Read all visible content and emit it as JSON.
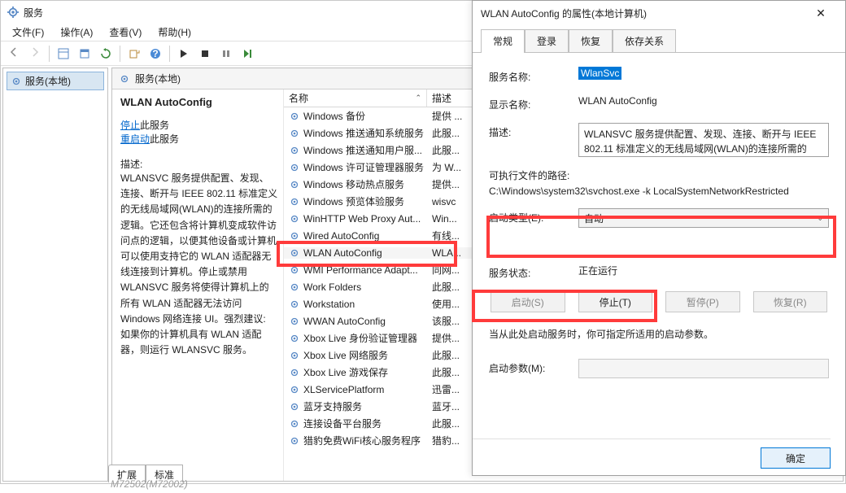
{
  "window": {
    "title": "服务",
    "menu": {
      "file": "文件(F)",
      "action": "操作(A)",
      "view": "查看(V)",
      "help": "帮助(H)"
    },
    "tree_root": "服务(本地)",
    "pane_header": "服务(本地)",
    "bottom_tabs": {
      "ext": "扩展",
      "std": "标准"
    },
    "footer_note": "M72502(M72002)"
  },
  "detail": {
    "name": "WLAN AutoConfig",
    "links": {
      "prefix": "",
      "stop": "停止",
      "stop_suffix": "此服务",
      "restart": "重启动",
      "restart_suffix": "此服务"
    },
    "desc_label": "描述:",
    "desc_text": "WLANSVC 服务提供配置、发现、连接、断开与 IEEE 802.11 标准定义的无线局域网(WLAN)的连接所需的逻辑。它还包含将计算机变成软件访问点的逻辑，以便其他设备或计算机可以使用支持它的 WLAN 适配器无线连接到计算机。停止或禁用 WLANSVC 服务将使得计算机上的所有 WLAN 适配器无法访问 Windows 网络连接 UI。强烈建议: 如果你的计算机具有 WLAN 适配器，则运行 WLANSVC 服务。"
  },
  "list": {
    "col_name": "名称",
    "col_desc": "描述",
    "rows": [
      {
        "name": "Windows 备份",
        "desc": "提供 ..."
      },
      {
        "name": "Windows 推送通知系统服务",
        "desc": "此服..."
      },
      {
        "name": "Windows 推送通知用户服...",
        "desc": "此服..."
      },
      {
        "name": "Windows 许可证管理器服务",
        "desc": "为 W..."
      },
      {
        "name": "Windows 移动热点服务",
        "desc": "提供..."
      },
      {
        "name": "Windows 预览体验服务",
        "desc": "wisvc"
      },
      {
        "name": "WinHTTP Web Proxy Aut...",
        "desc": "Win..."
      },
      {
        "name": "Wired AutoConfig",
        "desc": "有线..."
      },
      {
        "name": "WLAN AutoConfig",
        "desc": "WLA..."
      },
      {
        "name": "WMI Performance Adapt...",
        "desc": "同网..."
      },
      {
        "name": "Work Folders",
        "desc": "此服..."
      },
      {
        "name": "Workstation",
        "desc": "使用..."
      },
      {
        "name": "WWAN AutoConfig",
        "desc": "该服..."
      },
      {
        "name": "Xbox Live 身份验证管理器",
        "desc": "提供..."
      },
      {
        "name": "Xbox Live 网络服务",
        "desc": "此服..."
      },
      {
        "name": "Xbox Live 游戏保存",
        "desc": "此服..."
      },
      {
        "name": "XLServicePlatform",
        "desc": "迅雷..."
      },
      {
        "name": "蓝牙支持服务",
        "desc": "蓝牙..."
      },
      {
        "name": "连接设备平台服务",
        "desc": "此服..."
      },
      {
        "name": "猎豹免费WiFi核心服务程序",
        "desc": "猎豹..."
      }
    ],
    "selected_index": 8
  },
  "dialog": {
    "title": "WLAN AutoConfig 的属性(本地计算机)",
    "tabs": {
      "general": "常规",
      "logon": "登录",
      "recovery": "恢复",
      "deps": "依存关系"
    },
    "labels": {
      "svc_name": "服务名称:",
      "disp_name": "显示名称:",
      "desc": "描述:",
      "exe_path": "可执行文件的路径:",
      "startup": "启动类型(E):",
      "status": "服务状态:",
      "start_note": "当从此处启动服务时，你可指定所适用的启动参数。",
      "start_params": "启动参数(M):"
    },
    "values": {
      "svc_name": "WlanSvc",
      "disp_name": "WLAN AutoConfig",
      "desc": "WLANSVC 服务提供配置、发现、连接、断开与 IEEE 802.11 标准定义的无线局域网(WLAN)的连接所需的",
      "exe_path": "C:\\Windows\\system32\\svchost.exe -k LocalSystemNetworkRestricted",
      "startup": "自动",
      "status": "正在运行"
    },
    "buttons": {
      "start": "启动(S)",
      "stop": "停止(T)",
      "pause": "暂停(P)",
      "resume": "恢复(R)",
      "ok": "确定"
    }
  }
}
